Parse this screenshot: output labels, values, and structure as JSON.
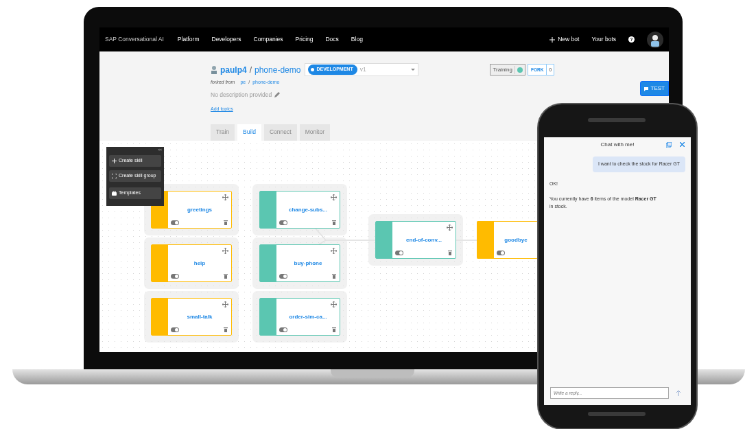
{
  "navbar": {
    "brand": "SAP Conversational AI",
    "links": [
      "Platform",
      "Developers",
      "Companies",
      "Pricing",
      "Docs",
      "Blog"
    ],
    "new_bot": "New bot",
    "your_bots": "Your bots",
    "help": "?"
  },
  "bot": {
    "owner": "paulp4",
    "separator": "/",
    "name": "phone-demo",
    "environment": "DEVELOPMENT",
    "version": "v1",
    "forked_from": "forked from",
    "fork_owner": "pe",
    "fork_separator": "/",
    "fork_repo": "phone-demo",
    "description": "No description provided",
    "add_topics": "Add topics",
    "training": "Training",
    "fork": "FORK",
    "fork_count": "0",
    "test": "TEST"
  },
  "tabs": [
    {
      "label": "Train",
      "selected": false
    },
    {
      "label": "Build",
      "selected": true
    },
    {
      "label": "Connect",
      "selected": false
    },
    {
      "label": "Monitor",
      "selected": false
    }
  ],
  "skill_menu": {
    "collapse": "<<",
    "items": [
      {
        "kind": "create",
        "label": "Create skill"
      },
      {
        "kind": "group",
        "label": "Create skill group"
      },
      {
        "kind": "templates",
        "label": "Templates"
      }
    ]
  },
  "skill_columns": [
    [
      {
        "name": "greetings",
        "color": "#ffbb00",
        "on": true
      },
      {
        "name": "help",
        "color": "#ffbb00",
        "on": true
      },
      {
        "name": "small-talk",
        "color": "#ffbb00",
        "on": true
      }
    ],
    [
      {
        "name": "change-subs...",
        "color": "#5bc6b1",
        "on": true
      },
      {
        "name": "buy-phone",
        "color": "#5bc6b1",
        "on": true
      },
      {
        "name": "order-sim-ca...",
        "color": "#5bc6b1",
        "on": true
      }
    ],
    [
      {
        "name": "end-of-conv...",
        "color": "#5bc6b1",
        "on": true
      }
    ],
    [
      {
        "name": "goodbye",
        "color": "#ffbb00",
        "on": true
      }
    ]
  ],
  "chat": {
    "title": "Chat with me!",
    "messages": [
      {
        "kind": "user",
        "text": "I want to check the stock for Racer GT"
      },
      {
        "kind": "bot",
        "text": "OK!"
      },
      {
        "kind": "bot",
        "text": "You currently have **6** items of the model **Racer GT** in stock."
      }
    ],
    "placeholder": "Write a reply..."
  }
}
